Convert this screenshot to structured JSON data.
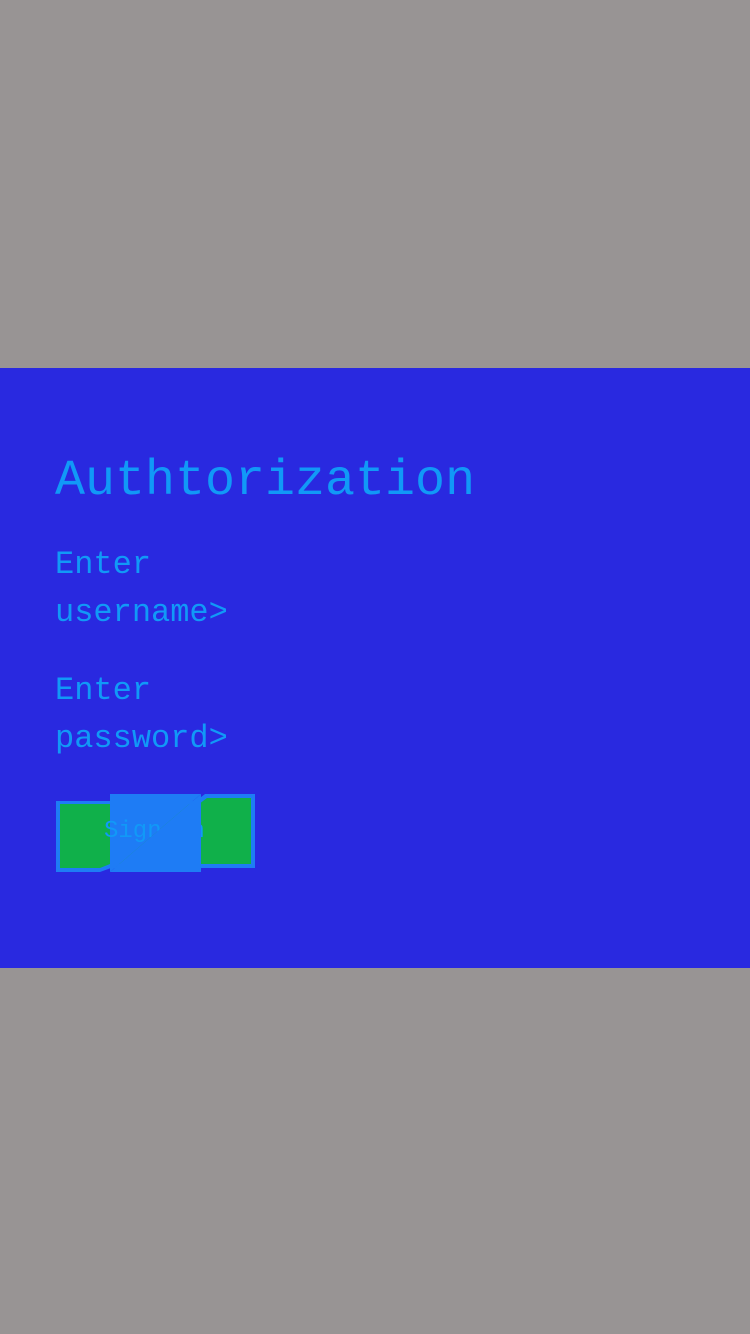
{
  "colors": {
    "background": "#989494",
    "panel": "#2929e0",
    "text": "#1199f7",
    "button_fill": "#10b04a",
    "button_border": "#1e7cf5"
  },
  "auth": {
    "title": "Authtorization",
    "username": {
      "line1": "Enter",
      "line2": "username>"
    },
    "password": {
      "line1": "Enter",
      "line2": "password>"
    },
    "sign_in_label": "Sign in",
    "icons": {
      "left_corner": "corner-top-left-icon",
      "right_corner": "corner-bottom-right-icon"
    }
  }
}
